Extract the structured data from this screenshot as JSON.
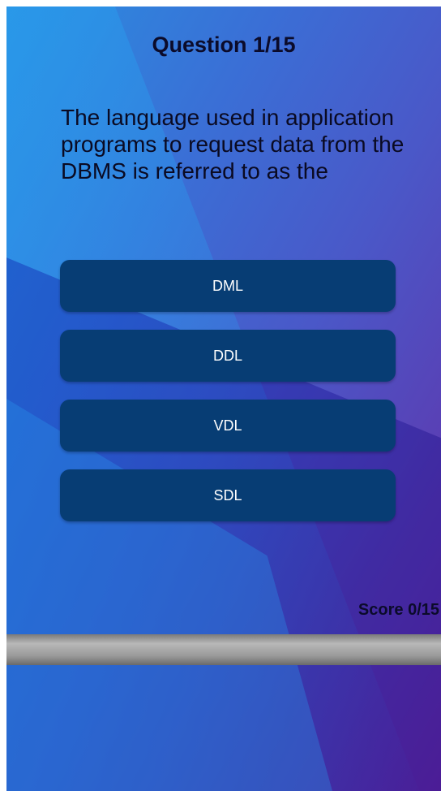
{
  "quiz": {
    "title": "Question 1/15",
    "question": "The language used in application programs to request data from the DBMS is referred to as the",
    "answers": [
      "DML",
      "DDL",
      "VDL",
      "SDL"
    ],
    "score": "Score 0/15",
    "progress": 0
  },
  "colors": {
    "answer_button": "#073d74",
    "background_start": "#2a8fe0",
    "background_end": "#6a2aa6"
  }
}
